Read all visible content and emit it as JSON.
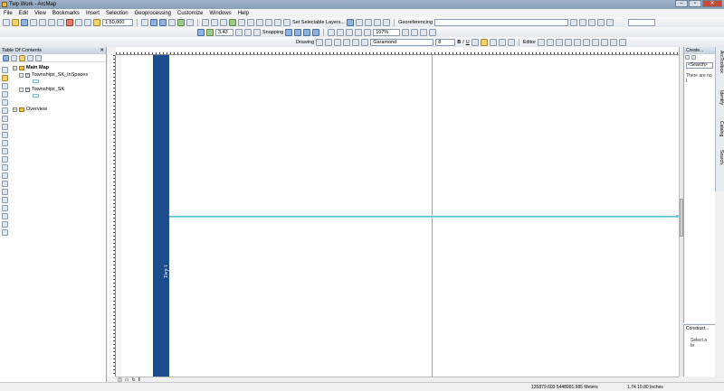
{
  "window": {
    "title": "Twp Work - ArcMap"
  },
  "menu": [
    "File",
    "Edit",
    "View",
    "Bookmarks",
    "Insert",
    "Selection",
    "Geoprocessing",
    "Customize",
    "Windows",
    "Help"
  ],
  "toolbar": {
    "scale_value": "1:50,000",
    "select_layers_label": "Set Selectable Layers...",
    "georeferencing_label": "Georeferencing",
    "snapping_label": "Snapping",
    "zoom_value": "3.43",
    "layout_zoom_value": "107%",
    "drawing_label": "Drawing",
    "font_name": "Garamond",
    "font_size": "8",
    "bold_label": "B",
    "italic_label": "I",
    "underline_label": "U",
    "editor_label": "Editor"
  },
  "toc": {
    "title": "Table Of Contents",
    "items": [
      {
        "label": "Main Map"
      },
      {
        "label": "Townships_SK_InSpaces"
      },
      {
        "label": "Townships_SK"
      },
      {
        "label": "Overview"
      }
    ]
  },
  "layout": {
    "strip_text": "Twp 1"
  },
  "create_panel": {
    "title": "Create...",
    "search_placeholder": "<Search>",
    "message": "There are no t"
  },
  "construct_panel": {
    "title": "Construct...",
    "message": "Select a te"
  },
  "sidetabs": [
    "ArcToolbox",
    "Identify",
    "Catalog",
    "Search"
  ],
  "status": {
    "coordinates": "135879.603  5448981.985 Meters",
    "page_size": "1.74  10.80 Inches"
  },
  "colors": {
    "strip": "#1b4d8f",
    "grid_line": "#5bc3d4"
  }
}
